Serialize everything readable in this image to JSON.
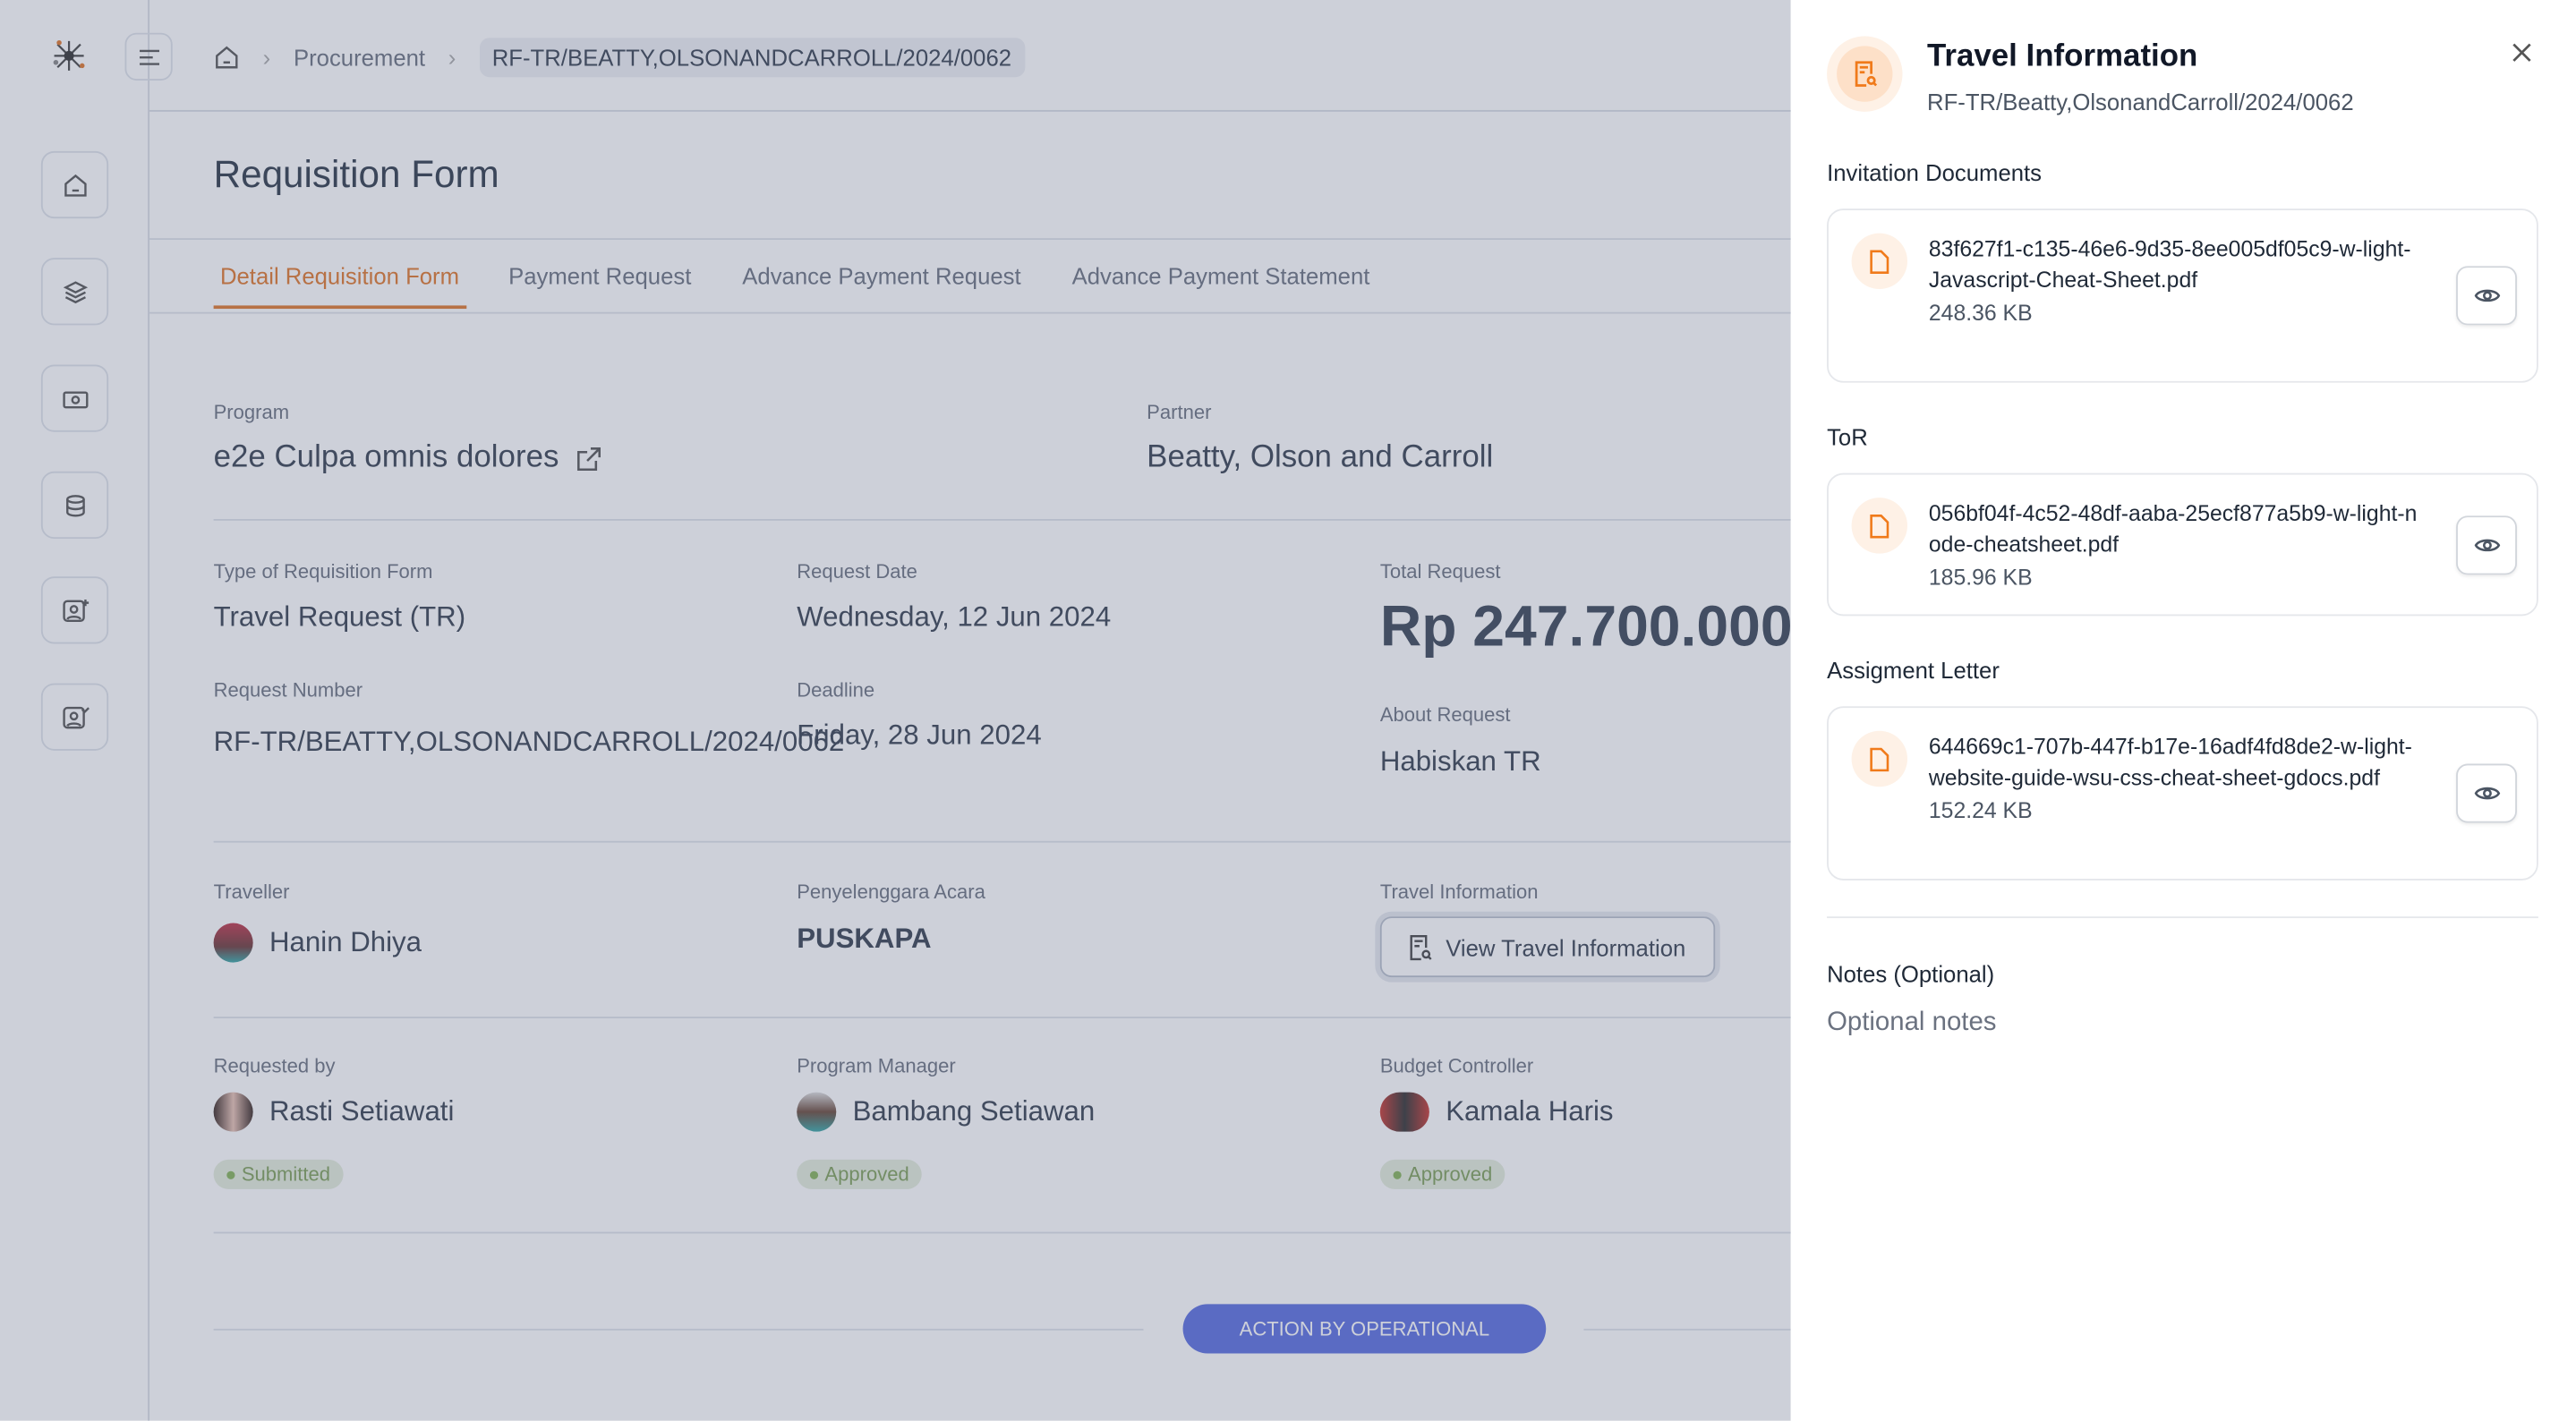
{
  "breadcrumb": {
    "items": [
      "Procurement"
    ],
    "current": "RF-TR/BEATTY,OLSONANDCARROLL/2024/0062"
  },
  "page_title": "Requisition Form",
  "tabs": [
    {
      "label": "Detail Requisition Form",
      "active": true
    },
    {
      "label": "Payment Request"
    },
    {
      "label": "Advance Payment Request"
    },
    {
      "label": "Advance Payment Statement"
    }
  ],
  "detail": {
    "program": {
      "label": "Program",
      "value": "e2e Culpa omnis dolores"
    },
    "partner": {
      "label": "Partner",
      "value": "Beatty, Olson and Carroll"
    },
    "type": {
      "label": "Type of Requisition Form",
      "value": "Travel Request (TR)"
    },
    "request_date": {
      "label": "Request Date",
      "value": "Wednesday, 12 Jun 2024"
    },
    "total": {
      "label": "Total Request",
      "value": "Rp 247.700.000"
    },
    "request_number": {
      "label": "Request Number",
      "value": "RF-TR/BEATTY,OLSONANDCARROLL/2024/0062"
    },
    "deadline": {
      "label": "Deadline",
      "value": "Friday, 28 Jun 2024"
    },
    "about": {
      "label": "About Request",
      "value": "Habiskan TR"
    },
    "traveller": {
      "label": "Traveller",
      "value": "Hanin Dhiya"
    },
    "organizer": {
      "label": "Penyelenggara Acara",
      "value": "PUSKAPA"
    },
    "travel_info": {
      "label": "Travel Information",
      "button": "View Travel Information"
    },
    "requested_by": {
      "label": "Requested by",
      "value": "Rasti Setiawati",
      "status": "Submitted"
    },
    "program_manager": {
      "label": "Program Manager",
      "value": "Bambang Setiawan",
      "status": "Approved"
    },
    "budget_controller": {
      "label": "Budget Controller",
      "value": "Kamala Haris",
      "status": "Approved"
    }
  },
  "action_button": "ACTION BY OPERATIONAL",
  "drawer": {
    "title": "Travel Information",
    "subtitle": "RF-TR/Beatty,OlsonandCarroll/2024/0062",
    "sections": [
      {
        "label": "Invitation Documents",
        "file": "83f627f1-c135-46e6-9d35-8ee005df05c9-w-light-Javascript-Cheat-Sheet.pdf",
        "size": "248.36 KB"
      },
      {
        "label": "ToR",
        "file": "056bf04f-4c52-48df-aaba-25ecf877a5b9-w-light-node-cheatsheet.pdf",
        "size": "185.96 KB"
      },
      {
        "label": "Assigment Letter",
        "file": "644669c1-707b-447f-b17e-16adf4fd8de2-w-light-website-guide-wsu-css-cheat-sheet-gdocs.pdf",
        "size": "152.24 KB"
      }
    ],
    "notes_label": "Notes (Optional)",
    "notes_value": "Optional notes"
  },
  "colors": {
    "accent": "#e0782c",
    "primary": "#4f63d2",
    "approved": "#86b45a"
  }
}
